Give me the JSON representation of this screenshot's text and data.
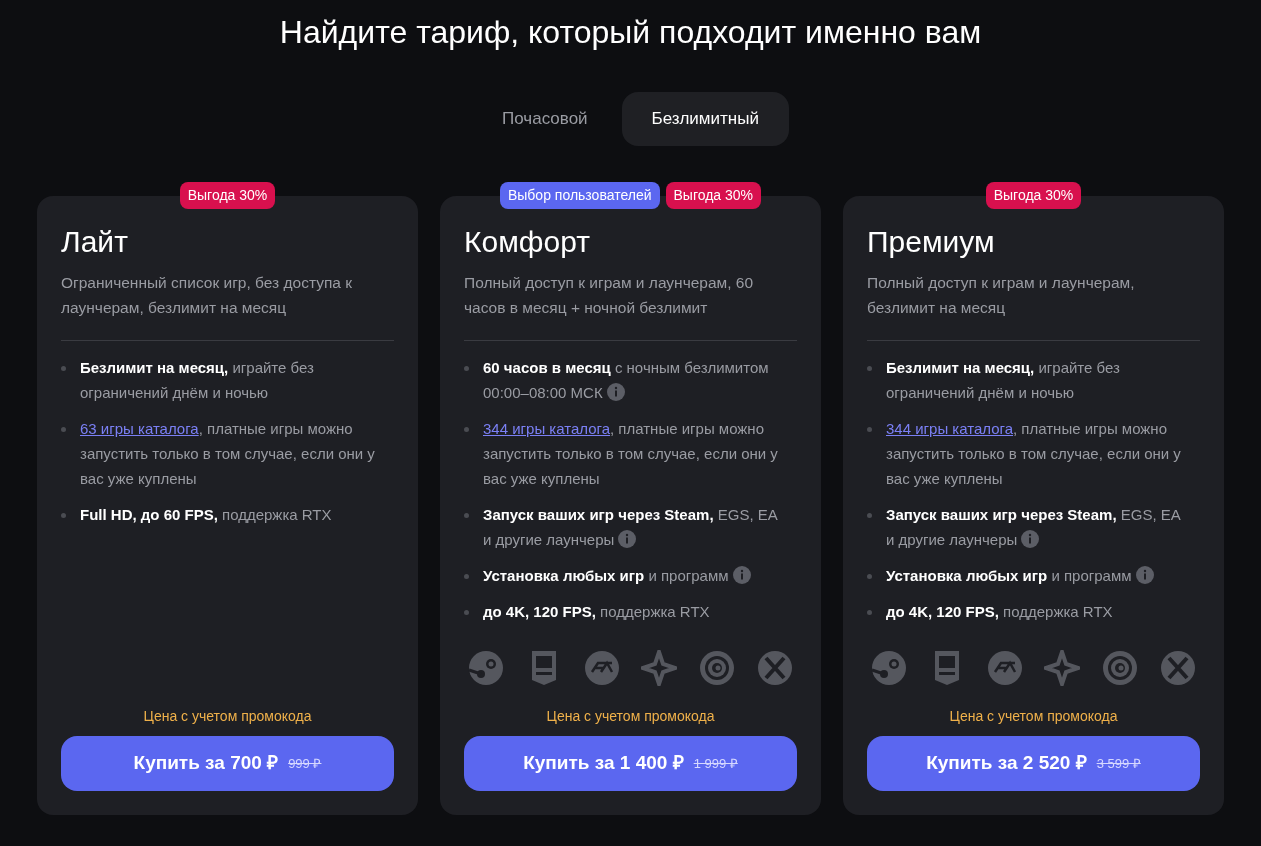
{
  "title": "Найдите тариф, который подходит именно вам",
  "tabs": [
    {
      "label": "Почасовой",
      "selected": false
    },
    {
      "label": "Безлимитный",
      "selected": true
    }
  ],
  "plans": [
    {
      "badges": [
        {
          "text": "Выгода 30%",
          "kind": "discount"
        }
      ],
      "name": "Лайт",
      "description": "Ограниченный список игр, без доступа к лаунчерам, безлимит на месяц",
      "features": [
        {
          "text": "**Безлимит на месяц,** играйте без ограничений днём и ночью",
          "info": false
        },
        {
          "link": "63 игры каталога",
          "text": ", платные игры можно запустить только в том случае, если они у вас уже куплены",
          "info": false
        },
        {
          "text": "**Full HD, до 60 FPS,** поддержка RTX",
          "info": false
        }
      ],
      "launchers": false,
      "promo": "Цена с учетом промокода",
      "price": "Купить за 700 ₽",
      "old_price": "999 ₽"
    },
    {
      "badges": [
        {
          "text": "Выбор пользователей",
          "kind": "choice"
        },
        {
          "text": "Выгода 30%",
          "kind": "discount"
        }
      ],
      "name": "Комфорт",
      "description": "Полный доступ к играм и лаунчерам, 60 часов в месяц + ночной безлимит",
      "features": [
        {
          "text": "**60 часов в месяц** с ночным безлимитом 00:00–08:00 МСК",
          "info": true
        },
        {
          "link": "344 игры каталога",
          "text": ", платные игры можно запустить только в том случае, если они у вас уже куплены",
          "info": false
        },
        {
          "text": "**Запуск ваших игр через Steam,** EGS, EA и другие лаунчеры",
          "info": true
        },
        {
          "text": "**Установка любых игр** и программ",
          "info": true
        },
        {
          "text": "**до 4K, 120 FPS,** поддержка RTX",
          "info": false
        }
      ],
      "launchers": true,
      "promo": "Цена с учетом промокода",
      "price": "Купить за 1 400 ₽",
      "old_price": "1 999 ₽"
    },
    {
      "badges": [
        {
          "text": "Выгода 30%",
          "kind": "discount"
        }
      ],
      "name": "Премиум",
      "description": "Полный доступ к играм и лаунчерам, безлимит на месяц",
      "features": [
        {
          "text": "**Безлимит на месяц,** играйте без ограничений днём и ночью",
          "info": false
        },
        {
          "link": "344 игры каталога",
          "text": ", платные игры можно запустить только в том случае, если они у вас уже куплены",
          "info": false
        },
        {
          "text": "**Запуск ваших игр через Steam,** EGS, EA и другие лаунчеры",
          "info": true
        },
        {
          "text": "**Установка любых игр** и программ",
          "info": true
        },
        {
          "text": "**до 4K, 120 FPS,** поддержка RTX",
          "info": false
        }
      ],
      "launchers": true,
      "promo": "Цена с учетом промокода",
      "price": "Купить за 2 520 ₽",
      "old_price": "3 599 ₽"
    }
  ]
}
